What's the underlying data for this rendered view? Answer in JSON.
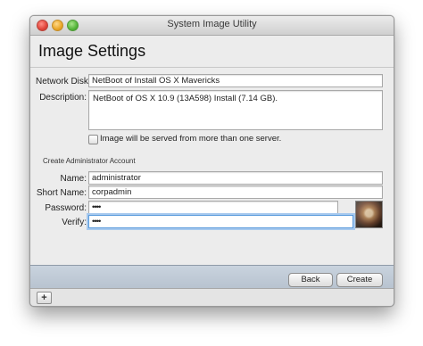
{
  "window": {
    "title": "System Image Utility"
  },
  "page": {
    "heading": "Image Settings"
  },
  "form": {
    "network_disk_label": "Network Disk:",
    "network_disk_value": "NetBoot of Install OS X Mavericks",
    "description_label": "Description:",
    "description_value": "NetBoot of OS X 10.9 (13A598) Install (7.14 GB).",
    "multi_server_label": "Image will be served from more than one server.",
    "multi_server_checked": false
  },
  "admin": {
    "section_title": "Create Administrator Account",
    "name_label": "Name:",
    "name_value": "administrator",
    "short_name_label": "Short Name:",
    "short_name_value": "corpadmin",
    "password_label": "Password:",
    "password_value": "••••",
    "verify_label": "Verify:",
    "verify_value": "••••"
  },
  "buttons": {
    "back": "Back",
    "create": "Create",
    "add": "+"
  },
  "icons": {
    "user_picture": "user-photo-icon"
  }
}
